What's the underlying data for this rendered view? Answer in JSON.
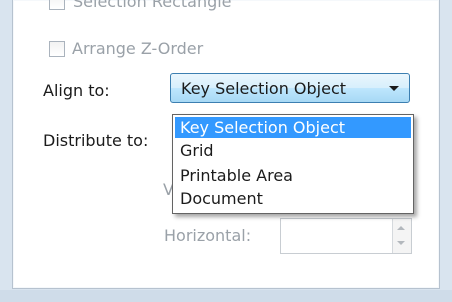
{
  "options": {
    "selection_rectangle_label": "Selection Rectangle",
    "arrange_zorder_label": "Arrange Z-Order"
  },
  "align": {
    "label": "Align to:",
    "selected_value": "Key Selection Object",
    "dropdown_items": [
      "Key Selection Object",
      "Grid",
      "Printable Area",
      "Document"
    ]
  },
  "distribute": {
    "label": "Distribute to:",
    "vertical_label": "V",
    "horizontal_label": "Horizontal:",
    "horizontal_value": ""
  }
}
